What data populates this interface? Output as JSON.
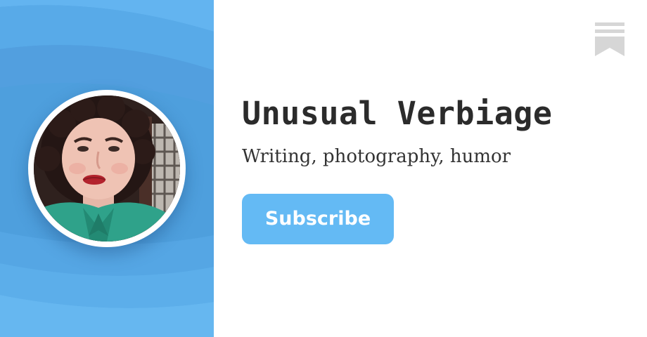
{
  "publication": {
    "title": "Unusual Verbiage",
    "tagline": "Writing, photography, humor"
  },
  "subscribe": {
    "label": "Subscribe"
  },
  "icons": {
    "logo": "substack-bookmark-icon",
    "avatar": "author-avatar"
  },
  "colors": {
    "panel_blue": "#4e9fdd",
    "button_blue": "#64baf4",
    "logo_gray": "#d6d6d6",
    "title_text": "#2b2b2b"
  }
}
